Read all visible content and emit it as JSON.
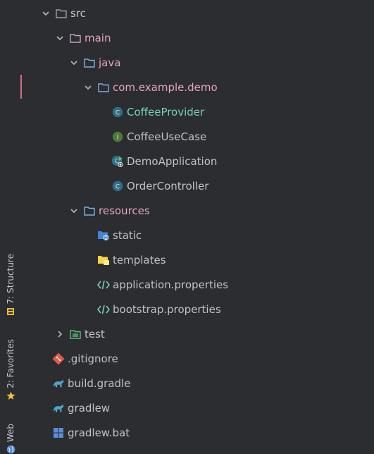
{
  "colors": {
    "background": "#2b2d30",
    "accent_bar": "#d86a8a",
    "folder_blue": "#7ab0e8",
    "folder_yellow": "#f2d54c",
    "class_teal": "#5aa3b7",
    "interface_green": "#6a9a4c",
    "git_red": "#e25a4b",
    "gradle_blue": "#4fa6c9",
    "windows_blue": "#5a8fd8"
  },
  "tool_strip": {
    "structure": "7: Structure",
    "favorites": "2: Favorites",
    "web": "Web"
  },
  "tree": {
    "items": [
      {
        "label": "src",
        "icon": "folder-icon",
        "expanded": true
      },
      {
        "label": "main",
        "icon": "folder-icon",
        "expanded": true
      },
      {
        "label": "java",
        "icon": "source-folder-icon",
        "expanded": true
      },
      {
        "label": "com.example.demo",
        "icon": "package-icon",
        "expanded": true
      },
      {
        "label": "CoffeeProvider",
        "icon": "class-icon"
      },
      {
        "label": "CoffeeUseCase",
        "icon": "interface-icon"
      },
      {
        "label": "DemoApplication",
        "icon": "spring-boot-class-icon"
      },
      {
        "label": "OrderController",
        "icon": "class-icon"
      },
      {
        "label": "resources",
        "icon": "resources-folder-icon",
        "expanded": true
      },
      {
        "label": "static",
        "icon": "web-folder-icon"
      },
      {
        "label": "templates",
        "icon": "templates-folder-icon"
      },
      {
        "label": "application.properties",
        "icon": "properties-file-icon"
      },
      {
        "label": "bootstrap.properties",
        "icon": "properties-file-icon"
      },
      {
        "label": "test",
        "icon": "test-folder-icon",
        "expanded": false
      },
      {
        "label": ".gitignore",
        "icon": "git-icon"
      },
      {
        "label": "build.gradle",
        "icon": "gradle-icon"
      },
      {
        "label": "gradlew",
        "icon": "gradle-icon"
      },
      {
        "label": "gradlew.bat",
        "icon": "windows-icon"
      }
    ]
  }
}
